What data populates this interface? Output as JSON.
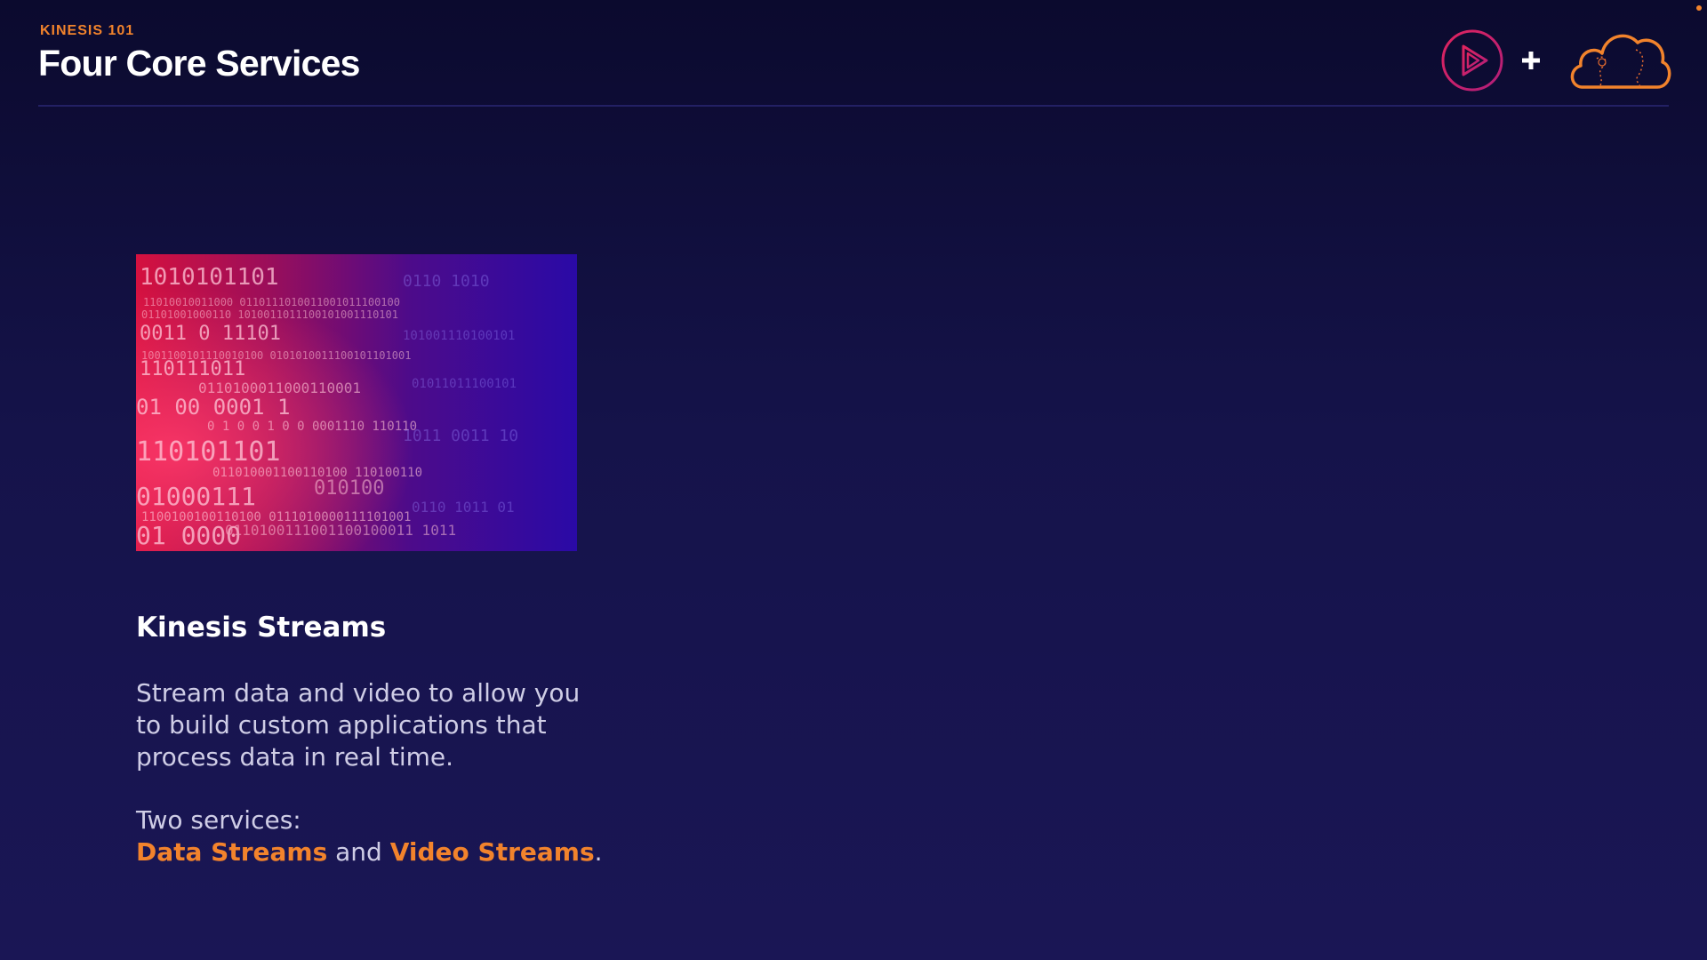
{
  "header": {
    "eyebrow": "KINESIS 101",
    "title": "Four Core Services"
  },
  "logos": {
    "play_icon": "play-circle-icon",
    "plus_icon": "plus-icon",
    "cloud_icon": "cloud-icon"
  },
  "card": {
    "image_icon": "binary-data-image",
    "heading": "Kinesis Streams",
    "description": "Stream data and video to allow you to build custom applications that process data in real time.",
    "services_intro": "Two services:",
    "service_1": "Data Streams",
    "connector": " and ",
    "service_2": "Video Streams",
    "end": "."
  },
  "colors": {
    "accent": "#f2832c",
    "background_top": "#0b0a2e",
    "background_bottom": "#1a1655",
    "play_icon": "#e0245e"
  }
}
